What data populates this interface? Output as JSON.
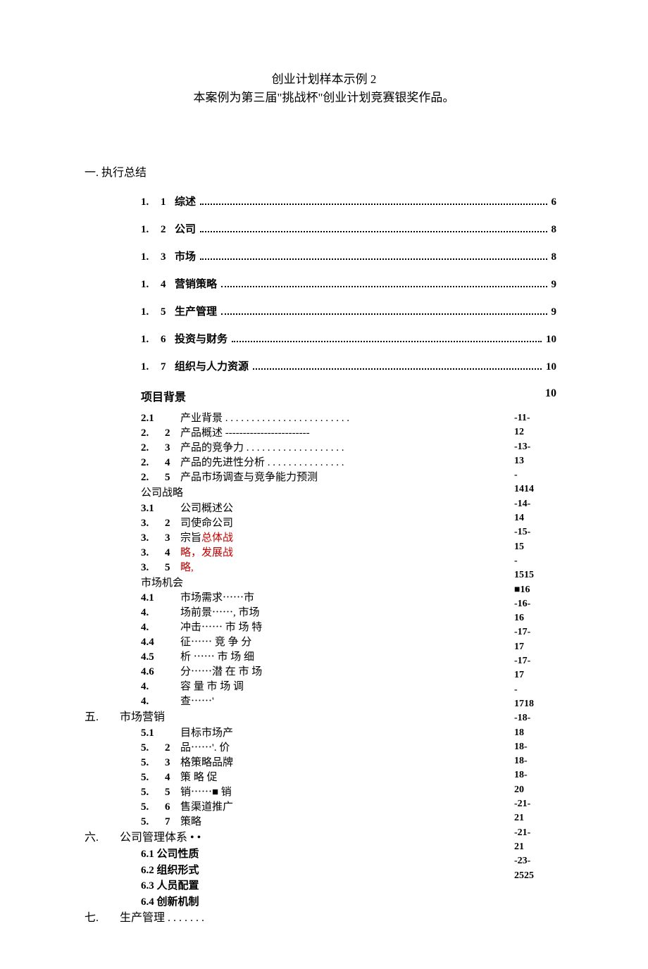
{
  "title": {
    "line1": "创业计划样本示例 2",
    "line2": "本案例为第三届\"挑战杯\"创业计划竞赛银奖作品。"
  },
  "heading1": "一. 执行总结",
  "toc1": [
    {
      "n": "1.",
      "s": "1",
      "label": "综述",
      "page": "6"
    },
    {
      "n": "1.",
      "s": "2",
      "label": "公司",
      "page": "8"
    },
    {
      "n": "1.",
      "s": "3",
      "label": "市场",
      "page": "8"
    },
    {
      "n": "1.",
      "s": "4",
      "label": "营销策略",
      "page": "9"
    },
    {
      "n": "1.",
      "s": "5",
      "label": "生产管理",
      "page": "9"
    },
    {
      "n": "1.",
      "s": "6",
      "label": "投资与财务",
      "page": "10"
    },
    {
      "n": "1.",
      "s": "7",
      "label": "组织与人力资源",
      "page": "10"
    }
  ],
  "project_bg": {
    "label": "项目背景",
    "page": "10"
  },
  "sec2": {
    "items": [
      {
        "n": "2.1",
        "s": "",
        "t": "产业背景 . . . . . . . . . . . . . . . . . . . . . . . ."
      },
      {
        "n": "2.",
        "s": "2",
        "t": "产品概述 ------------------------"
      },
      {
        "n": "2.",
        "s": "3",
        "t": "产品的竞争力 . . . . . . . . . . . . . . . . . . ."
      },
      {
        "n": "2.",
        "s": "4",
        "t": "产品的先进性分析 . . . . . . . . . . . . . . ."
      },
      {
        "n": "2.",
        "s": "5",
        "t": "产品市场调查与竞争能力预测"
      }
    ],
    "title": "公司战略"
  },
  "sec3": {
    "items": [
      {
        "n": "3.1",
        "s": "",
        "t": "公司概述公"
      },
      {
        "n": "3.",
        "s": "2",
        "t": "司使命公司"
      },
      {
        "n": "3.",
        "s": "3",
        "t_pre": "宗旨",
        "t_red": "总体战"
      },
      {
        "n": "3.",
        "s": "4",
        "t_red": "略，发展战"
      },
      {
        "n": "3.",
        "s": "5",
        "t_red": "略,"
      }
    ],
    "title": "市场机会"
  },
  "sec4": {
    "items": [
      {
        "n": "4.1",
        "s": "",
        "t": "市场需求⋯⋯市"
      },
      {
        "n": "4.",
        "s": "",
        "t": "场前景⋯⋯, 市场"
      },
      {
        "n": "4.",
        "s": "",
        "t": "冲击⋯⋯ 市 场 特"
      },
      {
        "n": "4.4",
        "s": "",
        "t": "征⋯⋯ 竞 争 分"
      },
      {
        "n": "4.5",
        "s": "",
        "t": "析 ⋯⋯  市 场 细"
      },
      {
        "n": "4.6",
        "s": "",
        "t": "分⋯⋯潜 在 市 场"
      },
      {
        "n": "4.",
        "s": "",
        "t": "容 量  市 场 调"
      },
      {
        "n": "4.",
        "s": "",
        "t": "查⋯⋯'"
      }
    ]
  },
  "roman5": {
    "num": "五.",
    "label": "市场营销"
  },
  "sec5": {
    "items": [
      {
        "n": "5.1",
        "s": "",
        "t": "目标市场产"
      },
      {
        "n": "5.",
        "s": "2",
        "t": "品⋯⋯'.  价"
      },
      {
        "n": "5.",
        "s": "3",
        "t": "格策略品牌"
      },
      {
        "n": "5.",
        "s": "4",
        "t": "策  略  促"
      },
      {
        "n": "5.",
        "s": "5",
        "t": "销⋯⋯■  销"
      },
      {
        "n": "5.",
        "s": "6",
        "t": "售渠道推广"
      },
      {
        "n": "5.",
        "s": "7",
        "t": "策略"
      }
    ]
  },
  "roman6": {
    "num": "六.",
    "label": "公司管理体系 • •"
  },
  "sec6": [
    "6.1 公司性质",
    "6.2 组织形式",
    "6.3 人员配置",
    "6.4 创新机制"
  ],
  "roman7": {
    "num": "七.",
    "label": "生产管理 . . . . . . ."
  },
  "right_pages": [
    "-11-",
    "12",
    "-13-",
    "13",
    "-",
    "1414",
    "-14-",
    "14",
    "-15-",
    "15",
    "-",
    "1515",
    "■16",
    "-16-",
    "16",
    "-17-",
    "17",
    "-17-",
    "17",
    "-",
    "1718",
    "-18-",
    "18",
    "18-",
    "18-",
    "18-",
    "20",
    "-21-",
    "21",
    "-21-",
    "21",
    "-23-",
    "2525"
  ]
}
